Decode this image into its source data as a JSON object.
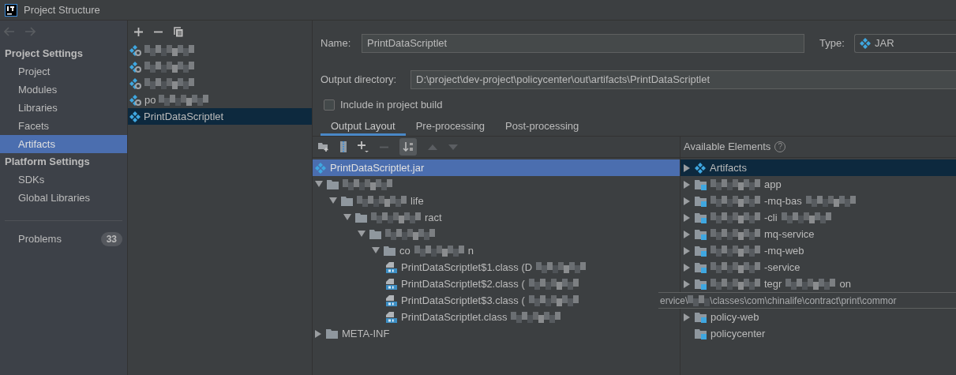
{
  "window": {
    "title": "Project Structure"
  },
  "sidebar": {
    "sections": [
      {
        "heading": "Project Settings",
        "items": [
          {
            "label": "Project",
            "selected": false
          },
          {
            "label": "Modules",
            "selected": false
          },
          {
            "label": "Libraries",
            "selected": false
          },
          {
            "label": "Facets",
            "selected": false
          },
          {
            "label": "Artifacts",
            "selected": true
          }
        ]
      },
      {
        "heading": "Platform Settings",
        "items": [
          {
            "label": "SDKs",
            "selected": false
          },
          {
            "label": "Global Libraries",
            "selected": false
          }
        ]
      }
    ],
    "problems": {
      "label": "Problems",
      "count": "33"
    }
  },
  "artifacts_list": [
    {
      "kind": "war",
      "segments": [
        {
          "kind": "blur"
        }
      ],
      "selected": false
    },
    {
      "kind": "war",
      "segments": [
        {
          "kind": "blur"
        }
      ],
      "selected": false
    },
    {
      "kind": "war",
      "segments": [
        {
          "kind": "blur"
        }
      ],
      "selected": false
    },
    {
      "kind": "war",
      "segments": [
        {
          "kind": "text",
          "text": "po"
        },
        {
          "kind": "blur"
        }
      ],
      "selected": false
    },
    {
      "kind": "jar",
      "segments": [
        {
          "kind": "text",
          "text": "PrintDataScriptlet"
        }
      ],
      "selected": true
    }
  ],
  "name_field": {
    "label": "Name:",
    "value": "PrintDataScriptlet"
  },
  "type_field": {
    "label": "Type:",
    "value": "JAR"
  },
  "output_directory": {
    "label": "Output directory:",
    "value": "D:\\project\\dev-project\\policycenter\\out\\artifacts\\PrintDataScriptlet"
  },
  "include_in_build": {
    "label": "Include in project build",
    "checked": false
  },
  "tabs": [
    {
      "label": "Output Layout",
      "selected": true
    },
    {
      "label": "Pre-processing",
      "selected": false
    },
    {
      "label": "Post-processing",
      "selected": false
    }
  ],
  "output_tree": [
    {
      "kind": "jar",
      "segments": [
        {
          "kind": "text",
          "text": "PrintDataScriptlet.jar"
        }
      ],
      "selected": true
    },
    {
      "kind": "folder",
      "segments": [
        {
          "kind": "blur"
        }
      ],
      "expanded": true,
      "selected": false,
      "children": [
        {
          "kind": "folder",
          "segments": [
            {
              "kind": "blur"
            },
            {
              "kind": "text",
              "text": "life"
            }
          ],
          "expanded": true,
          "selected": false,
          "children": [
            {
              "kind": "folder",
              "segments": [
                {
                  "kind": "blur"
                },
                {
                  "kind": "text",
                  "text": "ract"
                }
              ],
              "expanded": true,
              "selected": false,
              "children": [
                {
                  "kind": "folder",
                  "segments": [
                    {
                      "kind": "blur"
                    }
                  ],
                  "expanded": true,
                  "selected": false,
                  "children": [
                    {
                      "kind": "folder",
                      "segments": [
                        {
                          "kind": "text",
                          "text": "co"
                        },
                        {
                          "kind": "blur"
                        },
                        {
                          "kind": "text",
                          "text": "n"
                        }
                      ],
                      "expanded": true,
                      "selected": false,
                      "children": [
                        {
                          "kind": "class",
                          "segments": [
                            {
                              "kind": "text",
                              "text": "PrintDataScriptlet$1.class (D"
                            },
                            {
                              "kind": "blur"
                            }
                          ],
                          "selected": false
                        },
                        {
                          "kind": "class",
                          "segments": [
                            {
                              "kind": "text",
                              "text": "PrintDataScriptlet$2.class ("
                            },
                            {
                              "kind": "blur"
                            }
                          ],
                          "selected": false
                        },
                        {
                          "kind": "class",
                          "segments": [
                            {
                              "kind": "text",
                              "text": "PrintDataScriptlet$3.class ("
                            },
                            {
                              "kind": "blur"
                            }
                          ],
                          "selected": false
                        },
                        {
                          "kind": "class",
                          "segments": [
                            {
                              "kind": "text",
                              "text": "PrintDataScriptlet.class"
                            },
                            {
                              "kind": "blur"
                            }
                          ],
                          "selected": false
                        }
                      ]
                    }
                  ]
                }
              ]
            }
          ]
        }
      ]
    },
    {
      "kind": "folder",
      "segments": [
        {
          "kind": "text",
          "text": "META-INF"
        }
      ],
      "expanded": false,
      "selected": false
    }
  ],
  "available_elements": {
    "title": "Available Elements",
    "help": "?",
    "items": [
      {
        "kind": "artifacts",
        "segments": [
          {
            "kind": "text",
            "text": "Artifacts"
          }
        ],
        "expandable": true,
        "selected": true
      },
      {
        "kind": "module",
        "segments": [
          {
            "kind": "blur"
          },
          {
            "kind": "text",
            "text": "app"
          }
        ],
        "expandable": true,
        "selected": false
      },
      {
        "kind": "module",
        "segments": [
          {
            "kind": "blur"
          },
          {
            "kind": "text",
            "text": "-mq-bas"
          },
          {
            "kind": "blur"
          }
        ],
        "expandable": true,
        "selected": false
      },
      {
        "kind": "module",
        "segments": [
          {
            "kind": "blur"
          },
          {
            "kind": "text",
            "text": "-cli"
          },
          {
            "kind": "blur"
          }
        ],
        "expandable": true,
        "selected": false
      },
      {
        "kind": "module",
        "segments": [
          {
            "kind": "blur"
          },
          {
            "kind": "text",
            "text": "mq-service"
          }
        ],
        "expandable": true,
        "selected": false
      },
      {
        "kind": "module",
        "segments": [
          {
            "kind": "blur"
          },
          {
            "kind": "text",
            "text": "-mq-web"
          }
        ],
        "expandable": true,
        "selected": false
      },
      {
        "kind": "module",
        "segments": [
          {
            "kind": "blur"
          },
          {
            "kind": "text",
            "text": "-service"
          }
        ],
        "expandable": true,
        "selected": false
      },
      {
        "kind": "module",
        "segments": [
          {
            "kind": "blur"
          },
          {
            "kind": "text",
            "text": "tegr"
          },
          {
            "kind": "blur"
          },
          {
            "kind": "text",
            "text": "on"
          }
        ],
        "expandable": true,
        "selected": false
      },
      {
        "kind": "tooltip",
        "segments": [
          {
            "kind": "text",
            "text": "ervice\\"
          },
          {
            "kind": "blur"
          },
          {
            "kind": "text",
            "text": "\\classes\\com\\chinalife\\contract\\print\\commor"
          }
        ]
      },
      {
        "kind": "module",
        "segments": [
          {
            "kind": "text",
            "text": "policy-web"
          }
        ],
        "expandable": true,
        "selected": false
      },
      {
        "kind": "module",
        "segments": [
          {
            "kind": "text",
            "text": "policycenter"
          }
        ],
        "expandable": false,
        "selected": false
      }
    ]
  }
}
